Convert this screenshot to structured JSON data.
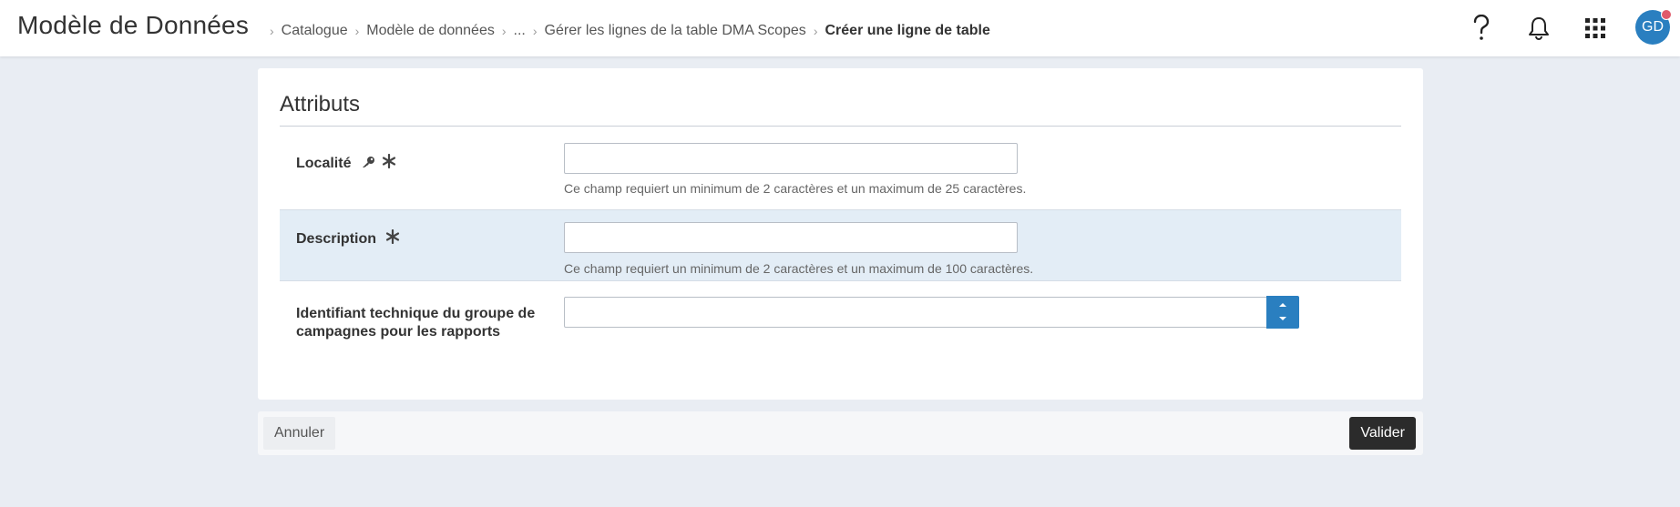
{
  "header": {
    "app_title": "Modèle de Données",
    "breadcrumb": [
      "Catalogue",
      "Modèle de données",
      "...",
      "Gérer les lignes de la table DMA Scopes",
      "Créer une ligne de table"
    ],
    "avatar_initials": "GD",
    "icons": [
      "help-icon",
      "bell-icon",
      "apps-grid-icon"
    ]
  },
  "form": {
    "section_title": "Attributs",
    "fields": [
      {
        "label": "Localité",
        "value": "",
        "help": "Ce champ requiert un minimum de 2 caractères et un maximum de 25 caractères."
      },
      {
        "label": "Description",
        "value": "",
        "help": "Ce champ requiert un minimum de 2 caractères et un maximum de 100 caractères."
      },
      {
        "label_line1": "Identifiant technique du groupe de",
        "label_line2": "campagnes pour les rapports",
        "value": ""
      }
    ]
  },
  "footer": {
    "cancel_label": "Annuler",
    "submit_label": "Valider"
  },
  "colors": {
    "accent": "#2a7fc0",
    "page_bg": "#e9edf3",
    "alt_row_bg": "#e3edf6",
    "submit_bg": "#2b2b2b",
    "notification_dot": "#e05a6b"
  }
}
